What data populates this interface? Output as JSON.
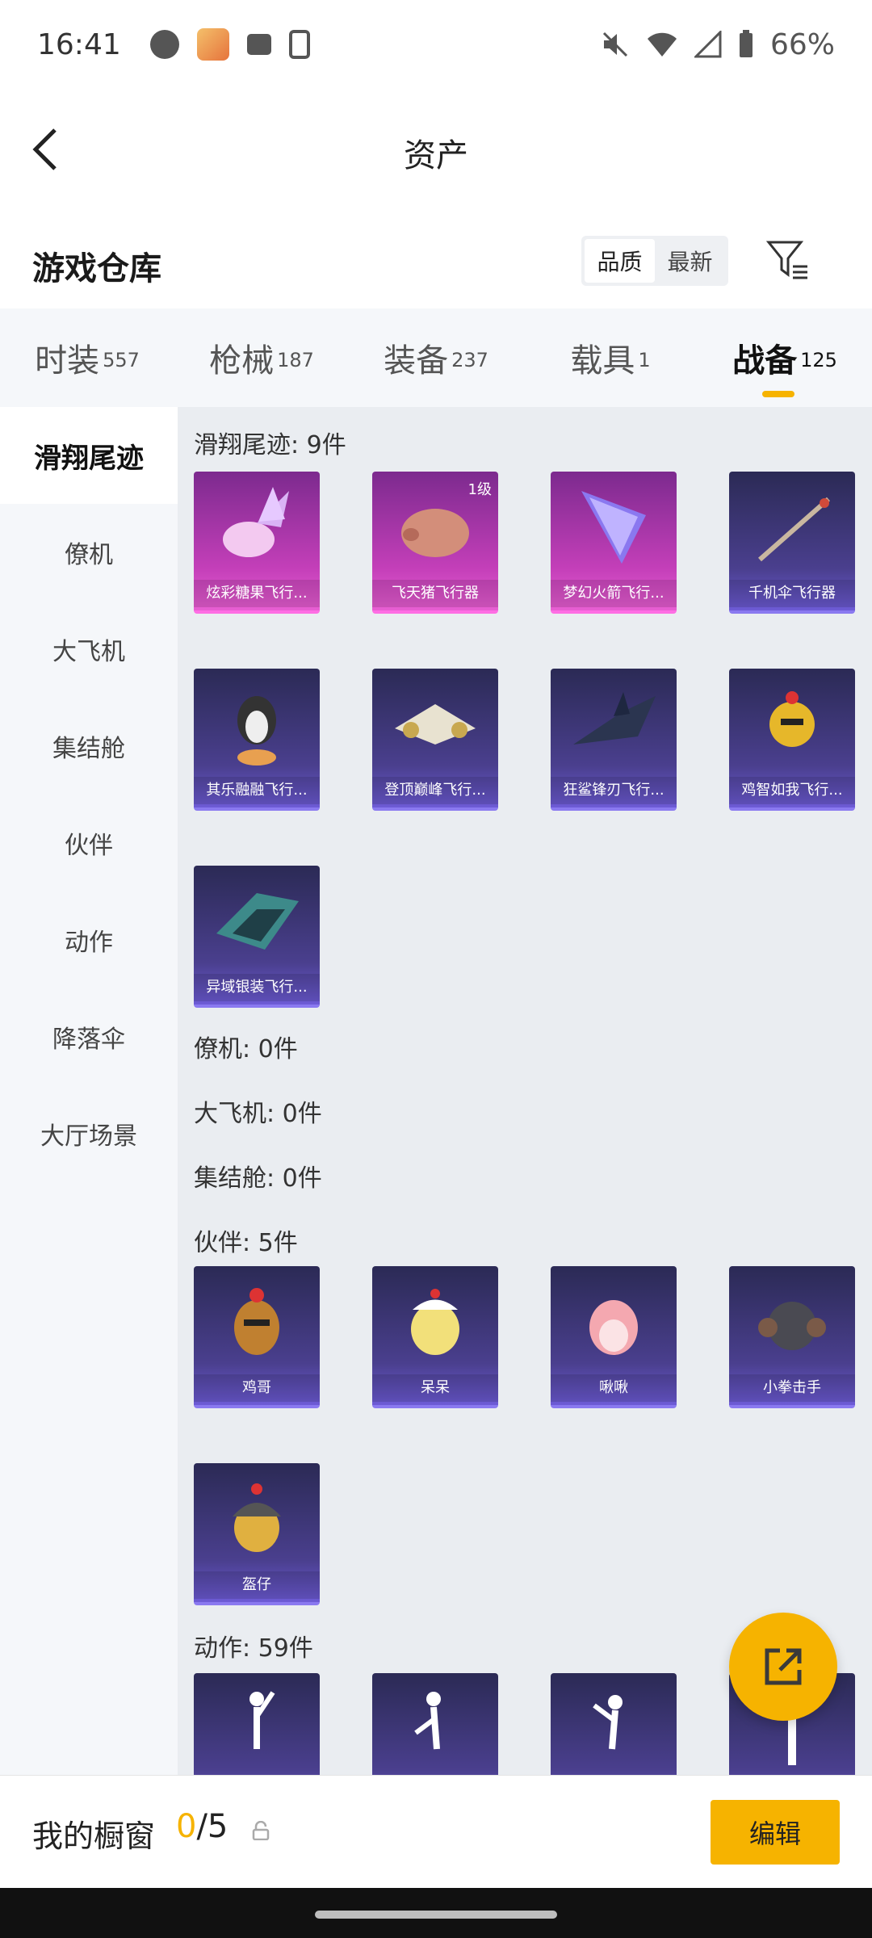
{
  "status_bar": {
    "time": "16:41",
    "battery": "66%"
  },
  "header": {
    "title": "资产"
  },
  "warehouse": {
    "title": "游戏仓库",
    "sort_options": [
      "品质",
      "最新"
    ],
    "active_sort": "品质"
  },
  "tabs": [
    {
      "label": "时装",
      "count": "557"
    },
    {
      "label": "枪械",
      "count": "187"
    },
    {
      "label": "装备",
      "count": "237"
    },
    {
      "label": "载具",
      "count": "1"
    },
    {
      "label": "战备",
      "count": "125"
    }
  ],
  "active_tab": "战备",
  "sidebar": {
    "items": [
      "滑翔尾迹",
      "僚机",
      "大飞机",
      "集结舱",
      "伙伴",
      "动作",
      "降落伞",
      "大厅场景"
    ],
    "active": "滑翔尾迹"
  },
  "groups": {
    "glider": {
      "title": "滑翔尾迹: 9件",
      "items": [
        {
          "name": "炫彩糖果飞行...",
          "rarity": "pink"
        },
        {
          "name": "飞天猪飞行器",
          "rarity": "pink",
          "badge": "1级"
        },
        {
          "name": "梦幻火箭飞行...",
          "rarity": "pink"
        },
        {
          "name": "千机伞飞行器",
          "rarity": "purple"
        },
        {
          "name": "其乐融融飞行...",
          "rarity": "purple"
        },
        {
          "name": "登顶巅峰飞行...",
          "rarity": "purple"
        },
        {
          "name": "狂鲨锋刃飞行...",
          "rarity": "purple"
        },
        {
          "name": "鸡智如我飞行...",
          "rarity": "purple"
        },
        {
          "name": "异域银装飞行...",
          "rarity": "purple"
        }
      ]
    },
    "wingman": {
      "title": "僚机: 0件"
    },
    "plane": {
      "title": "大飞机: 0件"
    },
    "capsule": {
      "title": "集结舱: 0件"
    },
    "partner": {
      "title": "伙伴: 5件",
      "items": [
        {
          "name": "鸡哥",
          "rarity": "purple"
        },
        {
          "name": "呆呆",
          "rarity": "purple"
        },
        {
          "name": "啾啾",
          "rarity": "purple"
        },
        {
          "name": "小拳击手",
          "rarity": "purple"
        },
        {
          "name": "盔仔",
          "rarity": "purple"
        }
      ]
    },
    "emote": {
      "title": "动作: 59件"
    }
  },
  "bottom_bar": {
    "label": "我的橱窗",
    "current": "0",
    "total": "/5",
    "edit_label": "编辑"
  },
  "colors": {
    "accent": "#f6b300",
    "pink_card": "#c43fb9",
    "purple_card": "#4a3f8e"
  }
}
